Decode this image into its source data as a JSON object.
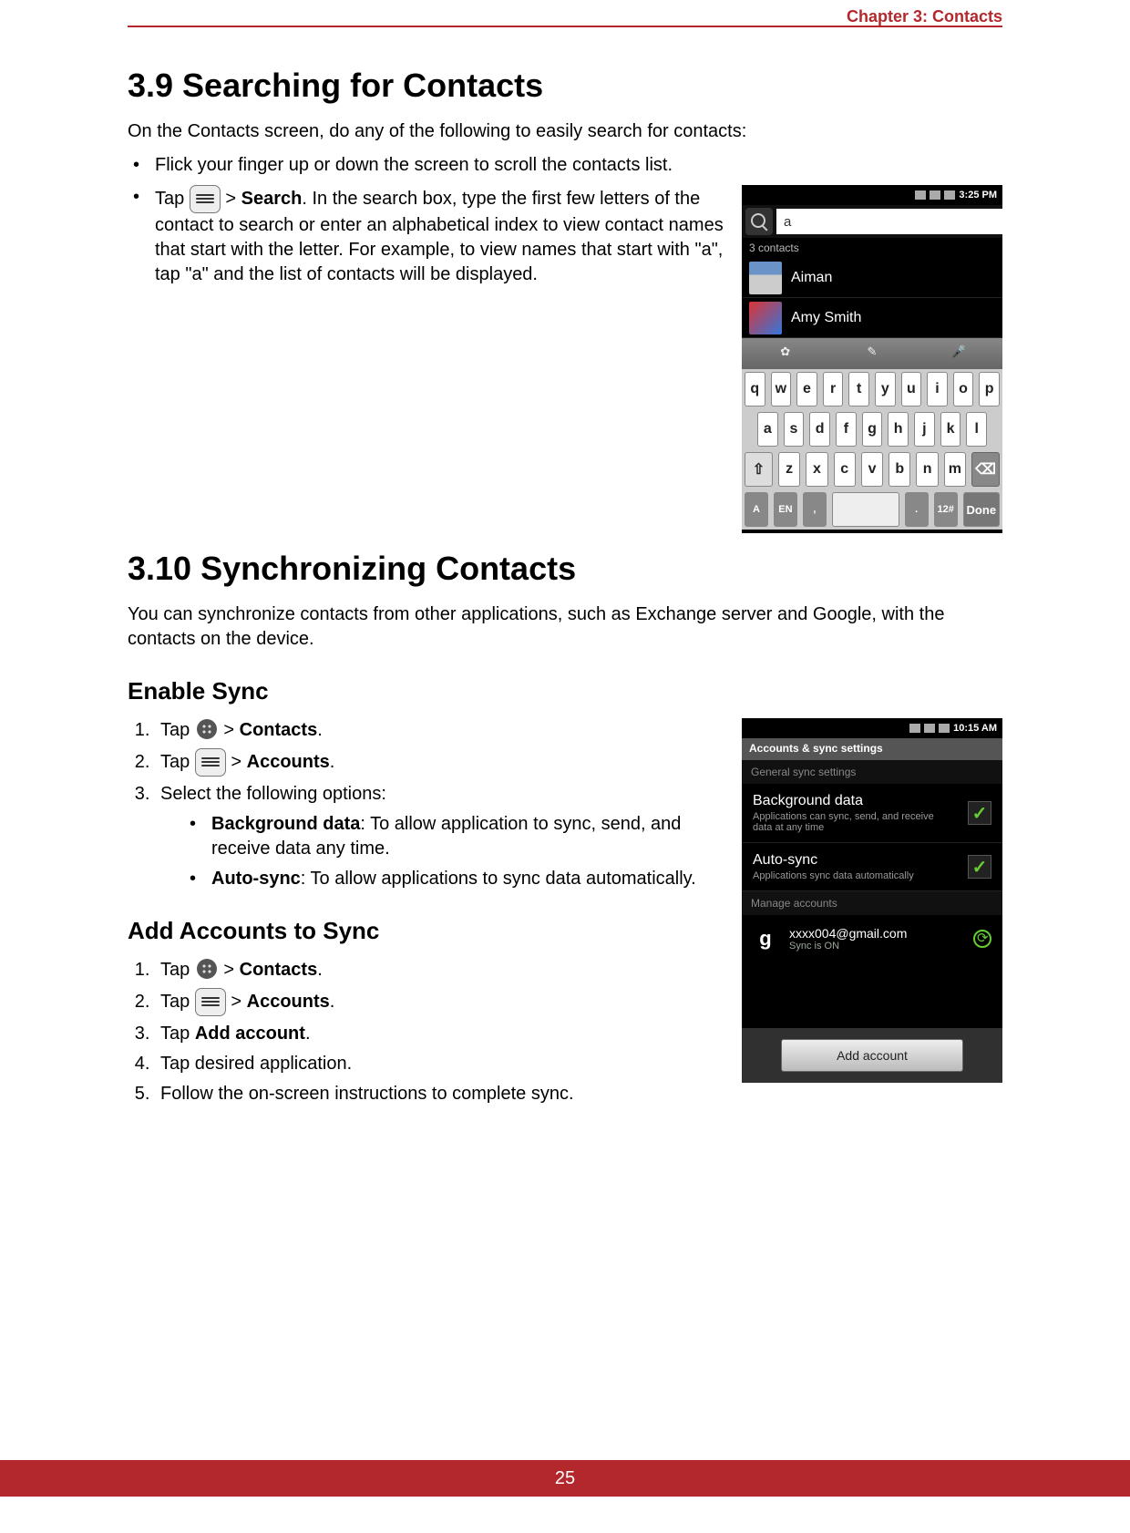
{
  "chapter_label": "Chapter 3: Contacts",
  "page_number": "25",
  "section_39": {
    "title": "3.9 Searching for Contacts",
    "intro": "On the Contacts screen, do any of the following to easily search for contacts:",
    "bullet1": "Flick your finger up or down the screen to scroll the contacts list.",
    "bullet2_pre": "Tap ",
    "bullet2_mid": " > ",
    "bullet2_bold": "Search",
    "bullet2_post": ". In the search box, type the first few letters of the contact to search or enter an alphabetical index to view contact names that start with the letter. For example, to view names that start with \"a\", tap \"a\" and the list of contacts will be displayed."
  },
  "phone1": {
    "time": "3:25 PM",
    "search_value": "a",
    "count": "3 contacts",
    "contacts": [
      "Aiman",
      "Amy Smith"
    ],
    "keys_row1": [
      "q",
      "w",
      "e",
      "r",
      "t",
      "y",
      "u",
      "i",
      "o",
      "p"
    ],
    "keys_row2": [
      "a",
      "s",
      "d",
      "f",
      "g",
      "h",
      "j",
      "k",
      "l"
    ],
    "keys_row3": [
      "z",
      "x",
      "c",
      "v",
      "b",
      "n",
      "m"
    ],
    "bottom": {
      "lang": "EN",
      "sym": "12#",
      "done": "Done"
    }
  },
  "section_310": {
    "title": "3.10 Synchronizing Contacts",
    "intro": "You can synchronize contacts from other applications, such as Exchange server and Google, with the contacts on the device.",
    "enable_title": "Enable Sync",
    "enable_steps": {
      "s1_pre": "Tap ",
      "s1_mid": " > ",
      "s1_bold": "Contacts",
      "s1_post": ".",
      "s2_pre": "Tap ",
      "s2_mid": " > ",
      "s2_bold": "Accounts",
      "s2_post": ".",
      "s3": "Select the following options:",
      "s3a_bold": "Background data",
      "s3a_rest": ": To allow application to sync, send, and receive data any time.",
      "s3b_bold": "Auto-sync",
      "s3b_rest": ": To allow applications to sync data automatically."
    },
    "add_title": "Add Accounts to Sync",
    "add_steps": {
      "s1_pre": "Tap ",
      "s1_mid": " > ",
      "s1_bold": "Contacts",
      "s1_post": ".",
      "s2_pre": "Tap ",
      "s2_mid": " > ",
      "s2_bold": "Accounts",
      "s2_post": ".",
      "s3_pre": "Tap ",
      "s3_bold": "Add account",
      "s3_post": ".",
      "s4": "Tap desired application.",
      "s5": "Follow the on-screen instructions to complete sync."
    }
  },
  "phone2": {
    "time": "10:15 AM",
    "title": "Accounts & sync settings",
    "sec1": "General sync settings",
    "item1_title": "Background data",
    "item1_desc": "Applications can sync, send, and receive data at any time",
    "item2_title": "Auto-sync",
    "item2_desc": "Applications sync data automatically",
    "sec2": "Manage accounts",
    "account_email": "xxxx004@gmail.com",
    "account_status": "Sync is ON",
    "g_label": "g",
    "add_button": "Add account"
  }
}
